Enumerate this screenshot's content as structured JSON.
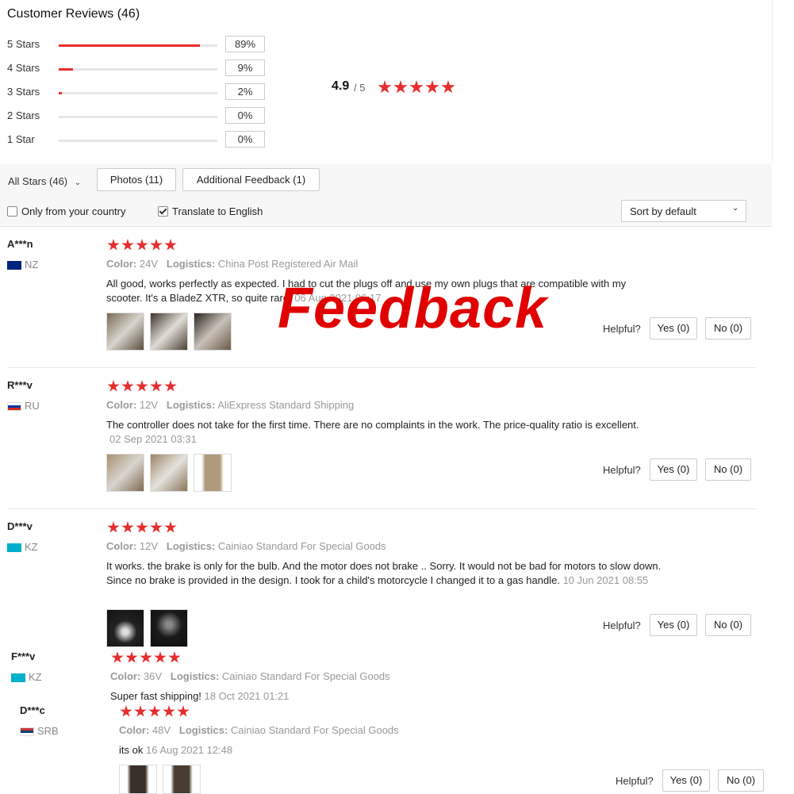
{
  "header": {
    "title": "Customer Reviews (46)"
  },
  "distribution": [
    {
      "label": "5 Stars",
      "pct": "89%",
      "fraction": 0.89
    },
    {
      "label": "4 Stars",
      "pct": "9%",
      "fraction": 0.09
    },
    {
      "label": "3 Stars",
      "pct": "2%",
      "fraction": 0.02
    },
    {
      "label": "2 Stars",
      "pct": "0%",
      "fraction": 0
    },
    {
      "label": "1 Star",
      "pct": "0%",
      "fraction": 0
    }
  ],
  "summary": {
    "average": "4.9",
    "of": "/ 5",
    "stars": 5
  },
  "filters": {
    "all_stars": "All Stars (46)",
    "photos": "Photos (11)",
    "additional": "Additional Feedback (1)",
    "only_country": "Only from your country",
    "translate": "Translate to English",
    "translate_checked": true,
    "only_country_checked": false,
    "sort": "Sort by default"
  },
  "overlay": {
    "text": "Feedback",
    "color": "#e00000"
  },
  "colors": {
    "accent": "#e62e2e"
  },
  "reviews": [
    {
      "user": "A***n",
      "country": "NZ",
      "stars": 5,
      "color_label": "Color:",
      "color_value": "24V",
      "log_label": "Logistics:",
      "log_value": "China Post Registered Air Mail",
      "text": "All good, works perfectly as expected. I had to cut the plugs off and use my own plugs that are compatible with my scooter. It's a BladeZ XTR, so quite rare.",
      "date": "06 Aug 2021 06:17",
      "helpful": "Helpful?",
      "yes": "Yes (0)",
      "no": "No (0)"
    },
    {
      "user": "R***v",
      "country": "RU",
      "stars": 5,
      "color_label": "Color:",
      "color_value": "12V",
      "log_label": "Logistics:",
      "log_value": "AliExpress Standard Shipping",
      "text": "The controller does not take for the first time. There are no complaints in the work. The price-quality ratio is excellent.",
      "date": "02 Sep 2021 03:31",
      "helpful": "Helpful?",
      "yes": "Yes (0)",
      "no": "No (0)"
    },
    {
      "user": "D***v",
      "country": "KZ",
      "stars": 5,
      "color_label": "Color:",
      "color_value": "12V",
      "log_label": "Logistics:",
      "log_value": "Cainiao Standard For Special Goods",
      "text": "It works. the brake is only for the bulb. And the motor does not brake .. Sorry. It would not be bad for motors to slow down. Since no brake is provided in the design. I took for a child's motorcycle I changed it to a gas handle.",
      "date": "10 Jun 2021 08:55",
      "helpful": "Helpful?",
      "yes": "Yes (0)",
      "no": "No (0)"
    },
    {
      "user": "F***v",
      "country": "KZ",
      "stars": 5,
      "color_label": "Color:",
      "color_value": "36V",
      "log_label": "Logistics:",
      "log_value": "Cainiao Standard For Special Goods",
      "text": "Super fast shipping!",
      "date": "18 Oct 2021 01:21"
    },
    {
      "user": "D***c",
      "country": "SRB",
      "stars": 5,
      "color_label": "Color:",
      "color_value": "48V",
      "log_label": "Logistics:",
      "log_value": "Cainiao Standard For Special Goods",
      "text": "its ok",
      "date": "16 Aug 2021 12:48",
      "helpful": "Helpful?",
      "yes": "Yes (0)",
      "no": "No (0)"
    }
  ]
}
